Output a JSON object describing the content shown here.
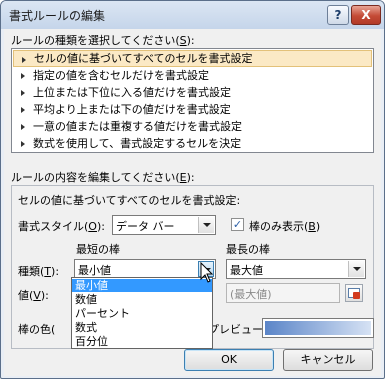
{
  "window": {
    "title": "書式ルールの編集",
    "help_button": "?",
    "close_button": "X"
  },
  "rule_type": {
    "heading": "ルールの種類を選択してください(",
    "accel": "S",
    "heading_end": "):",
    "items": [
      "セルの値に基づいてすべてのセルを書式設定",
      "指定の値を含むセルだけを書式設定",
      "上位または下位に入る値だけを書式設定",
      "平均より上または下の値だけを書式設定",
      "一意の値または重複する値だけを書式設定",
      "数式を使用して、書式設定するセルを決定"
    ],
    "selected_index": 0
  },
  "rule_edit": {
    "heading": "ルールの内容を編集してください(",
    "accel": "E",
    "heading_end": "):",
    "description": "セルの値に基づいてすべてのセルを書式設定:",
    "format_style_label": "書式スタイル(",
    "format_style_accel": "O",
    "format_style_end": "):",
    "format_style_value": "データ バー",
    "bar_only_label": "棒のみ表示(",
    "bar_only_accel": "B",
    "bar_only_end": ")",
    "bar_only_checked": true,
    "shortest_heading": "最短の棒",
    "longest_heading": "最長の棒",
    "type_label": "種類(",
    "type_accel": "T",
    "type_end": "):",
    "shortest_type_value": "最小値",
    "longest_type_value": "最大値",
    "value_label": "値(",
    "value_accel": "V",
    "value_end": "):",
    "longest_value_placeholder": "(最大値)",
    "bar_color_label": "棒の色(",
    "preview_label": "プレビュー:",
    "bar_color": "#5b85c8"
  },
  "dropdown": {
    "options": [
      "最小値",
      "数値",
      "パーセント",
      "数式",
      "百分位"
    ],
    "highlighted_index": 0
  },
  "buttons": {
    "ok": "OK",
    "cancel": "キャンセル"
  }
}
